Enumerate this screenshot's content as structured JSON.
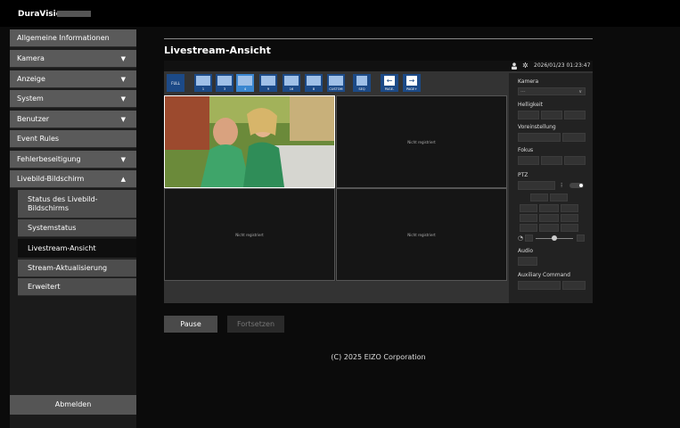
{
  "header": {
    "logo": "DuraVision"
  },
  "sidebar": {
    "items": [
      {
        "label": "Allgemeine Informationen",
        "arrow": ""
      },
      {
        "label": "Kamera",
        "arrow": "▼"
      },
      {
        "label": "Anzeige",
        "arrow": "▼"
      },
      {
        "label": "System",
        "arrow": "▼"
      },
      {
        "label": "Benutzer",
        "arrow": "▼"
      },
      {
        "label": "Event Rules",
        "arrow": ""
      },
      {
        "label": "Fehlerbeseitigung",
        "arrow": "▼"
      },
      {
        "label": "Livebild-Bildschirm",
        "arrow": "▲"
      }
    ],
    "sub_items": [
      "Status des Livebild-Bildschirms",
      "Systemstatus",
      "Livestream-Ansicht",
      "Stream-Aktualisierung",
      "Erweitert"
    ],
    "logout": "Abmelden"
  },
  "main": {
    "title": "Livestream-Ansicht",
    "datetime": "2026/01/23 01:23:47",
    "layout_buttons": [
      "FULL",
      "1",
      "3",
      "4",
      "9",
      "16",
      "8",
      "CUSTOM",
      "SEQ",
      "PAGE-",
      "PAGE+"
    ],
    "cells": [
      "",
      "Nicht registriert",
      "Nicht registriert",
      "Nicht registriert"
    ],
    "controls": {
      "camera_label": "Kamera",
      "camera_value": "---",
      "brightness_label": "Helligkeit",
      "preset_label": "Voreinstellung",
      "focus_label": "Fokus",
      "ptz_label": "PTZ",
      "audio_label": "Audio",
      "aux_label": "Auxiliary Command"
    }
  },
  "buttons": {
    "pause": "Pause",
    "resume": "Fortsetzen"
  },
  "footer": {
    "copyright": "(C) 2025 EIZO Corporation"
  },
  "colors": {
    "accent": "#3a86d0",
    "sidebar_item": "#5a5a5a",
    "active_item": "#0e0e0e"
  }
}
